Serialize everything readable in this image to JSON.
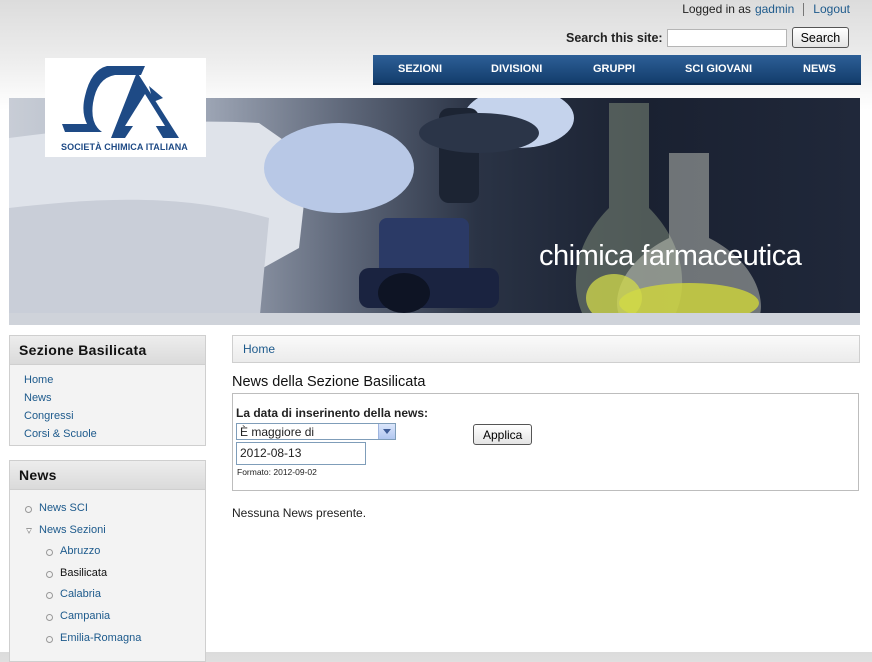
{
  "user": {
    "logged_in_text": "Logged in as",
    "username": "gadmin",
    "logout": "Logout"
  },
  "search": {
    "label": "Search this site:",
    "value": "",
    "button": "Search"
  },
  "nav": [
    "SEZIONI",
    "DIVISIONI",
    "GRUPPI",
    "SCI GIOVANI",
    "NEWS"
  ],
  "logo": {
    "text": "SOCIETÀ CHIMICA ITALIANA"
  },
  "banner": {
    "caption": "chimica farmaceutica"
  },
  "sidebar": {
    "section": {
      "title": "Sezione Basilicata",
      "items": [
        "Home",
        "News",
        "Congressi",
        "Corsi & Scuole"
      ]
    },
    "news": {
      "title": "News",
      "items": [
        {
          "label": "News SCI"
        },
        {
          "label": "News Sezioni"
        }
      ],
      "sub_items": [
        {
          "label": "Abruzzo",
          "active": false
        },
        {
          "label": "Basilicata",
          "active": true
        },
        {
          "label": "Calabria",
          "active": false
        },
        {
          "label": "Campania",
          "active": false
        },
        {
          "label": "Emilia-Romagna",
          "active": false
        }
      ]
    }
  },
  "main": {
    "breadcrumb": "Home",
    "title": "News della Sezione Basilicata",
    "filter": {
      "label": "La data di inserinento della news:",
      "operator": "È maggiore di",
      "date_value": "2012-08-13",
      "format_hint": "Formato: 2012-09-02",
      "apply": "Applica"
    },
    "empty_message": "Nessuna News presente."
  },
  "colors": {
    "nav_bg": "#1f4b80",
    "link": "#1d5a8c",
    "active_item": "#111111"
  }
}
